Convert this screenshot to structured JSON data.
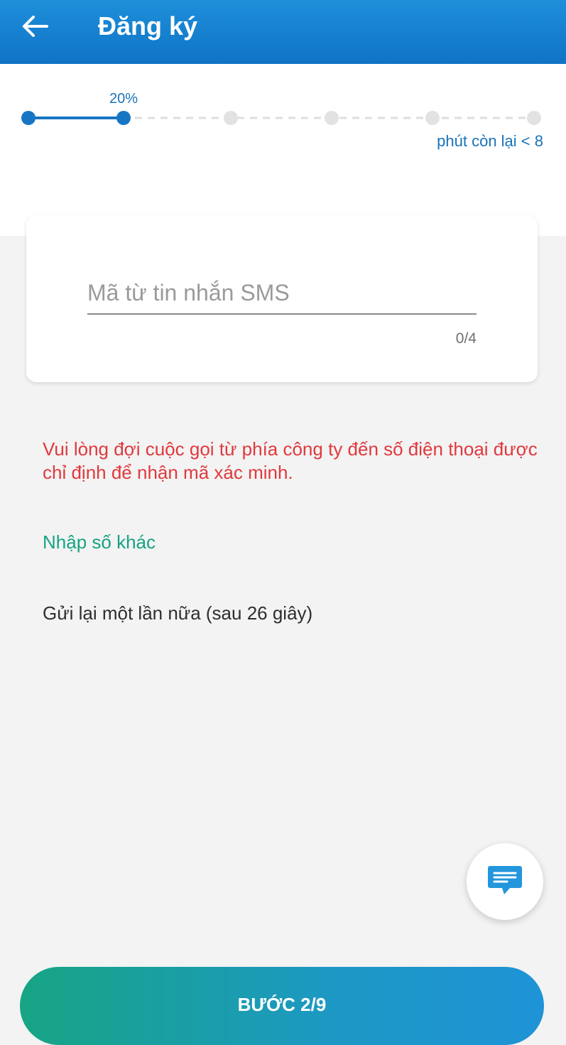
{
  "header": {
    "title": "Đăng ký",
    "back_icon": "arrow-left-icon",
    "background": "#1279c9"
  },
  "progress": {
    "percent_label": "20%",
    "value": 0.2,
    "steps_total": 6,
    "active_step": 2,
    "time_left_label": "phút còn lại < 8",
    "active_color": "#1776c3",
    "inactive_color": "#dedede"
  },
  "sms_card": {
    "placeholder": "Mã từ tin nhắn SMS",
    "value": "",
    "counter": "0/4"
  },
  "notice": {
    "text": "Vui lòng đợi cuộc gọi từ phía công ty đến số điện thoại được chỉ định để nhận mã xác minh.",
    "color": "#e0393d"
  },
  "links": {
    "other_number": "Nhập số khác",
    "resend": "Gửi lại một lần nữa (sau 26 giây)"
  },
  "chat": {
    "icon": "chat-message-icon",
    "color": "#2396dc"
  },
  "footer": {
    "step_button": "BƯỚC 2/9"
  }
}
